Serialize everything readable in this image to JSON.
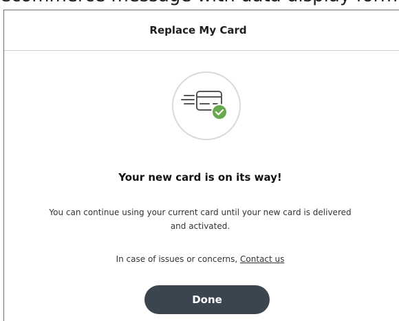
{
  "top_caption": "ecommerce message with data display form",
  "modal": {
    "title": "Replace My Card",
    "icon": "card-shipping-check-icon",
    "headline": "Your new card is on its way!",
    "body": "You can continue using your current card until your new card is delivered and activated.",
    "issues_prefix": "In case of issues or concerns, ",
    "contact_link": "Contact us",
    "done_label": "Done"
  },
  "colors": {
    "button_bg": "#3b4550",
    "check_badge": "#6aa84f",
    "icon_stroke": "#555555"
  }
}
